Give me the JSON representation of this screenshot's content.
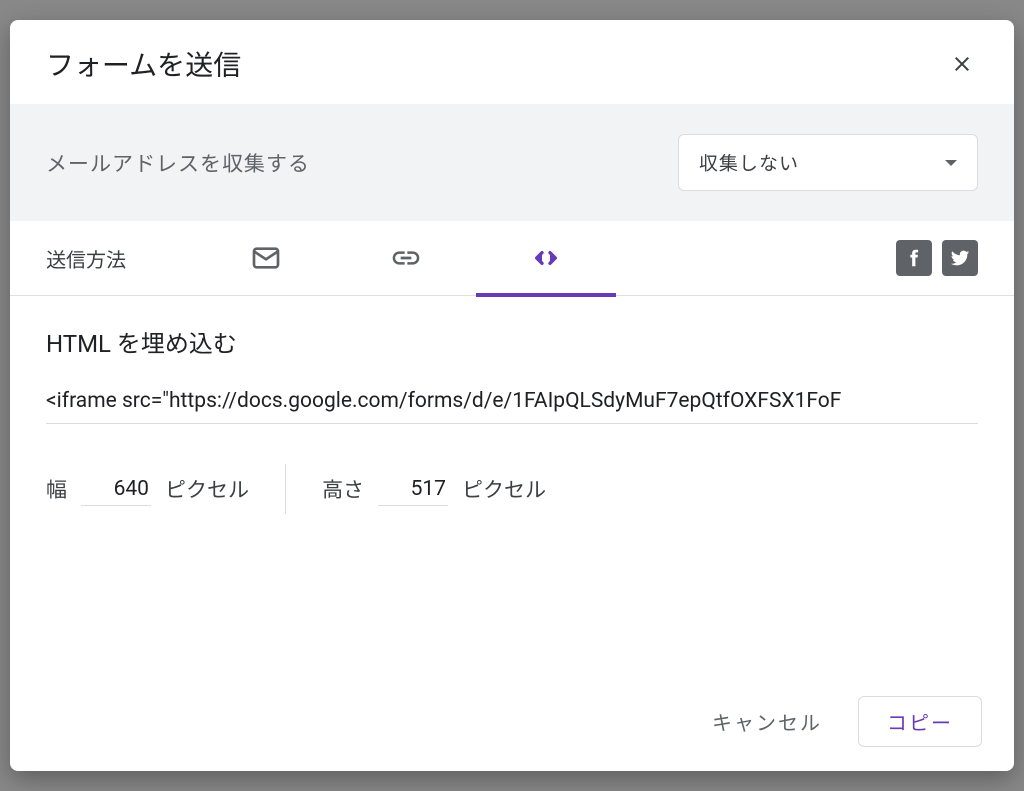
{
  "dialog": {
    "title": "フォームを送信"
  },
  "collect": {
    "label": "メールアドレスを収集する",
    "dropdown_value": "収集しない"
  },
  "tabs": {
    "label": "送信方法"
  },
  "embed": {
    "title": "HTML を埋め込む",
    "code": "<iframe src=\"https://docs.google.com/forms/d/e/1FAIpQLSdyMuF7epQtfOXFSX1FoF"
  },
  "dimensions": {
    "width_label": "幅",
    "width_value": "640",
    "width_unit": "ピクセル",
    "height_label": "高さ",
    "height_value": "517",
    "height_unit": "ピクセル"
  },
  "footer": {
    "cancel": "キャンセル",
    "copy": "コピー"
  },
  "colors": {
    "accent": "#673ab7"
  }
}
